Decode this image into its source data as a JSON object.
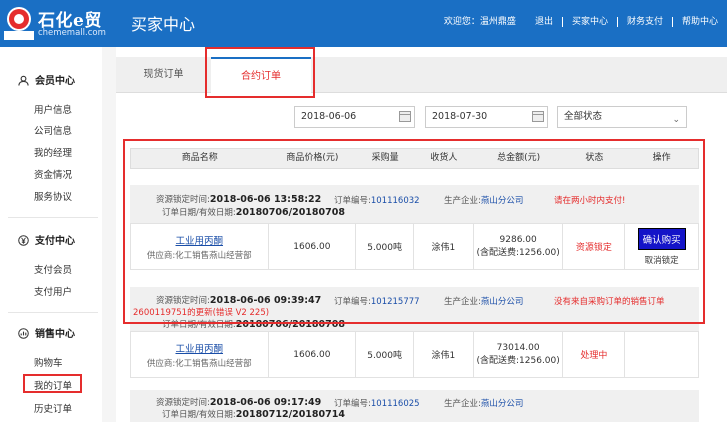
{
  "header": {
    "logo_text": "石化e贸",
    "logo_sub": "chememall.com",
    "logo_badge": "SINOPEC",
    "title": "买家中心",
    "nav": [
      "欢迎您：温州鼎盛",
      "退出",
      "买家中心",
      "财务支付",
      "帮助中心"
    ]
  },
  "sidebar": {
    "sections": [
      {
        "title": "会员中心",
        "icon": "user-icon",
        "items": [
          "用户信息",
          "公司信息",
          "我的经理",
          "资金情况",
          "服务协议"
        ]
      },
      {
        "title": "支付中心",
        "icon": "yen-icon",
        "items": [
          "支付会员",
          "支付用户"
        ]
      },
      {
        "title": "销售中心",
        "icon": "chart-icon",
        "items": [
          "购物车",
          "我的订单",
          "历史订单"
        ]
      }
    ],
    "active_item": "我的订单"
  },
  "tabs": [
    {
      "label": "现货订单",
      "active": false
    },
    {
      "label": "合约订单",
      "active": true
    }
  ],
  "filters": {
    "start_date": "2018-06-06",
    "end_date": "2018-07-30",
    "status": "全部状态"
  },
  "table": {
    "columns": [
      "商品名称",
      "商品价格(元)",
      "采购量",
      "收货人",
      "总金额(元)",
      "状态",
      "操作"
    ]
  },
  "orders": [
    {
      "lock_label": "资源锁定时间:",
      "lock_time": "2018-06-06 13:58:22",
      "order_no_label": "订单编号:",
      "order_no": "101116032",
      "producer_label": "生产企业:",
      "producer": "燕山分公司",
      "notice": "请在两小时内支付!",
      "dates_label": "订单日期/有效日期:",
      "dates": "20180706/20180708",
      "product": "工业用丙酮",
      "supplier": "供应商:化工销售燕山经营部",
      "price": "1606.00",
      "quantity": "5.000吨",
      "receiver": "涂伟1",
      "total": "9286.00",
      "total_note": "(含配送费:1256.00)",
      "status": "资源锁定",
      "action_primary": "确认购买",
      "action_secondary": "取消锁定"
    },
    {
      "lock_label": "资源锁定时间:",
      "lock_time": "2018-06-06 09:39:47",
      "order_no_label": "订单编号:",
      "order_no": "101215777",
      "producer_label": "生产企业:",
      "producer": "燕山分公司",
      "notice": "没有来自采购订单的销售订单",
      "error_line": "2600119751的更新(错误 V2 225)",
      "dates_label": "订单日期/有效日期:",
      "dates": "20180706/20180708",
      "product": "工业用丙酮",
      "supplier": "供应商:化工销售燕山经营部",
      "price": "1606.00",
      "quantity": "5.000吨",
      "receiver": "涂伟1",
      "total": "73014.00",
      "total_note": "(含配送费:1256.00)",
      "status": "处理中"
    },
    {
      "lock_label": "资源锁定时间:",
      "lock_time": "2018-06-06 09:17:49",
      "order_no_label": "订单编号:",
      "order_no": "101116025",
      "producer_label": "生产企业:",
      "producer": "燕山分公司",
      "dates_label": "订单日期/有效日期:",
      "dates": "20180712/20180714"
    }
  ],
  "colors": {
    "brand": "#1a6fc4",
    "alert": "#e52d2d",
    "button": "#1414c8"
  }
}
